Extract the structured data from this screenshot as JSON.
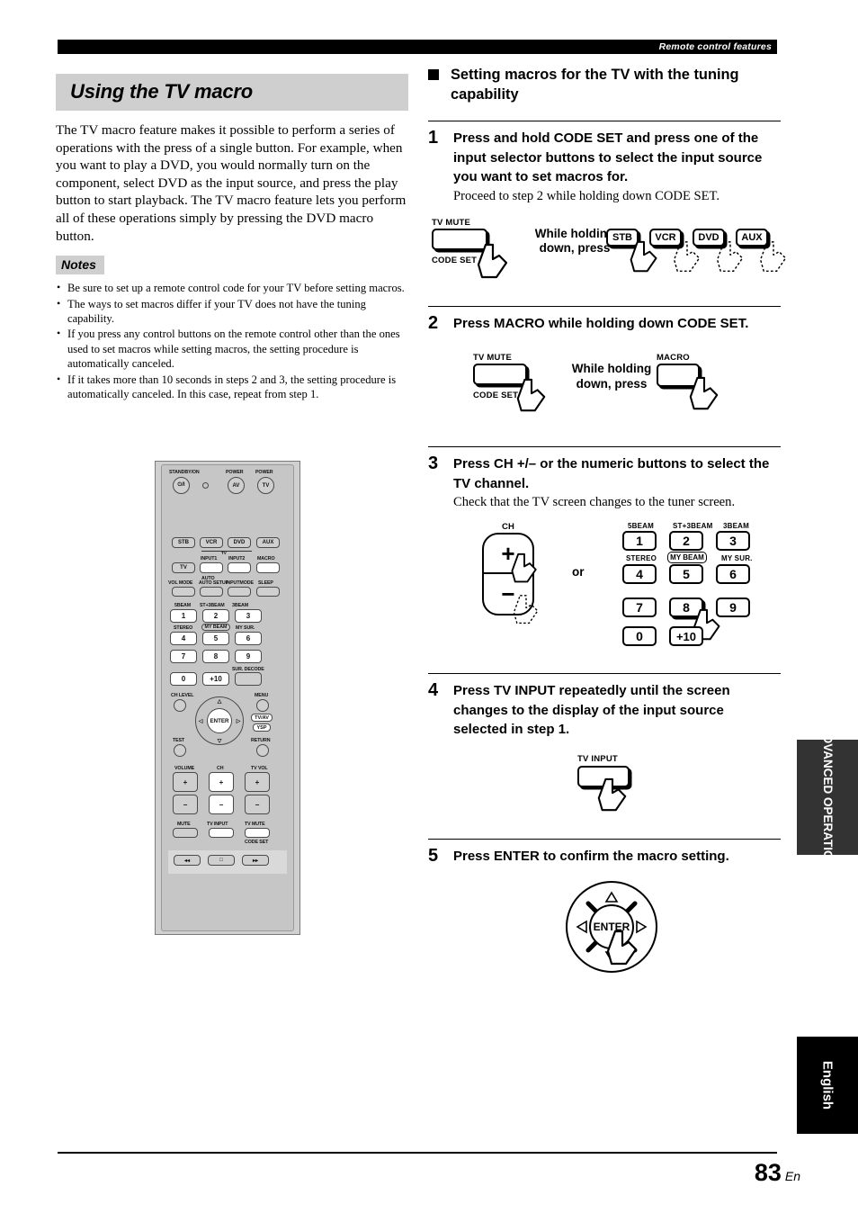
{
  "header": {
    "running_head": "Remote control features"
  },
  "left": {
    "title": "Using the TV macro",
    "intro": "The TV macro feature makes it possible to perform a series of operations with the press of a single button. For example, when you want to play a DVD, you would normally turn on the component, select DVD as the input source, and press the play button to start playback. The TV macro feature lets you perform all of these operations simply by pressing the DVD macro button.",
    "notes_label": "Notes",
    "notes": [
      "Be sure to set up a remote control code for your TV before setting macros.",
      "The ways to set macros differ if your TV does not have the tuning capability.",
      "If you press any control buttons on the remote control other than the ones used to set macros while setting macros, the setting procedure is automatically canceled.",
      "If it takes more than 10 seconds in steps 2 and 3, the setting procedure is automatically canceled. In this case, repeat from step 1."
    ]
  },
  "remote": {
    "standby_label": "STANDBY/ON",
    "standby_glyph": "⏻/I",
    "power_av_label": "POWER",
    "power_av": "AV",
    "power_tv_label": "POWER",
    "power_tv": "TV",
    "source_buttons": [
      "STB",
      "VCR",
      "DVD",
      "AUX"
    ],
    "tv_button": "TV",
    "tv_small_label": "TV",
    "input_row_labels": [
      "INPUT1",
      "INPUT2",
      "MACRO"
    ],
    "mode_row_labels": [
      "VOL MODE",
      "AUTO SETUP",
      "INPUTMODE",
      "SLEEP"
    ],
    "num_top_labels": [
      "5BEAM",
      "ST+3BEAM",
      "3BEAM"
    ],
    "num_mid_labels": [
      "STEREO",
      "MY BEAM",
      "MY SUR."
    ],
    "numbers": [
      "1",
      "2",
      "3",
      "4",
      "5",
      "6",
      "7",
      "8",
      "9",
      "0",
      "+10"
    ],
    "sur_decode": "SUR. DECODE",
    "ch_level": "CH LEVEL",
    "menu": "MENU",
    "test": "TEST",
    "return": "RETURN",
    "enter": "ENTER",
    "tv_av": "TV/AV",
    "ysp": "YSP",
    "volume": "VOLUME",
    "ch": "CH",
    "tv_vol": "TV VOL",
    "plus": "+",
    "minus": "−",
    "mute": "MUTE",
    "tv_input": "TV INPUT",
    "tv_mute": "TV MUTE",
    "code_set": "CODE SET"
  },
  "right": {
    "section_title": "Setting macros for the TV with the tuning capability",
    "steps": [
      {
        "num": "1",
        "bold": "Press and hold CODE SET and press one of the input selector buttons to select the input source you want to set macros for.",
        "sub": "Proceed to step 2 while holding down CODE SET."
      },
      {
        "num": "2",
        "bold": "Press MACRO while holding down CODE SET.",
        "sub": ""
      },
      {
        "num": "3",
        "bold": "Press CH +/– or the numeric buttons to select the TV channel.",
        "sub": "Check that the TV screen changes to the tuner screen."
      },
      {
        "num": "4",
        "bold": "Press TV INPUT repeatedly until the screen changes to the display of the input source selected in step 1.",
        "sub": ""
      },
      {
        "num": "5",
        "bold": "Press ENTER to confirm the macro setting.",
        "sub": ""
      }
    ],
    "fig1": {
      "tv_mute": "TV MUTE",
      "code_set": "CODE SET",
      "hold_line1": "While holding",
      "hold_line2": "down, press",
      "keys": [
        "STB",
        "VCR",
        "DVD",
        "AUX"
      ]
    },
    "fig2": {
      "tv_mute": "TV MUTE",
      "code_set": "CODE SET",
      "hold_line1": "While holding",
      "hold_line2": "down, press",
      "macro": "MACRO"
    },
    "fig3": {
      "ch": "CH",
      "plus": "+",
      "minus": "−",
      "or": "or",
      "labels_top": [
        "5BEAM",
        "ST+3BEAM",
        "3BEAM"
      ],
      "labels_mid": [
        "STEREO",
        "MY BEAM",
        "MY SUR."
      ],
      "keys": [
        "1",
        "2",
        "3",
        "4",
        "5",
        "6",
        "7",
        "8",
        "9",
        "0",
        "+10"
      ]
    },
    "fig4": {
      "tv_input": "TV INPUT"
    },
    "fig5": {
      "enter": "ENTER"
    }
  },
  "tabs": {
    "advanced": "ADVANCED OPERATION",
    "language": "English"
  },
  "footer": {
    "page": "83",
    "lang_code": "En"
  }
}
